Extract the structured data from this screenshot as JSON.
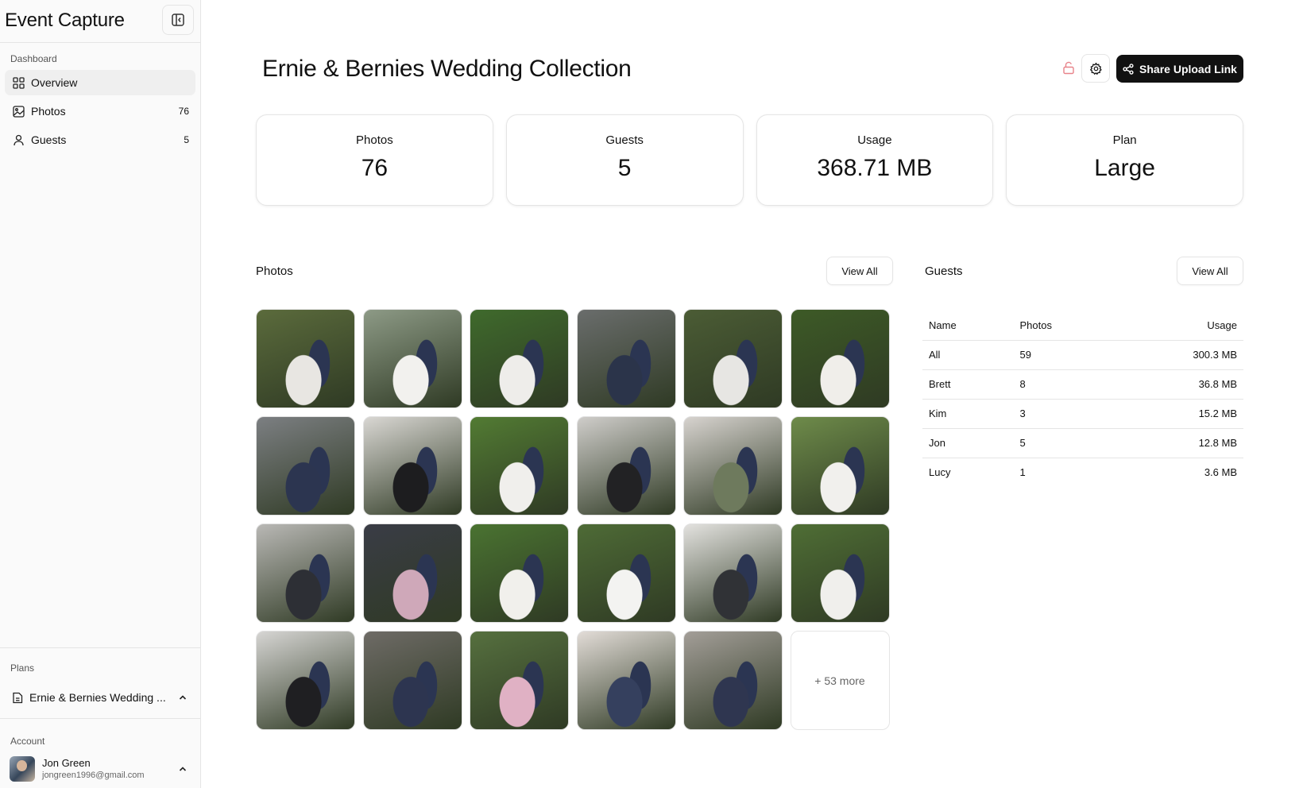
{
  "app": {
    "title": "Event Capture"
  },
  "sidebar": {
    "dashboard_label": "Dashboard",
    "items": [
      {
        "label": "Overview",
        "icon": "grid-icon",
        "count": ""
      },
      {
        "label": "Photos",
        "icon": "image-icon",
        "count": "76"
      },
      {
        "label": "Guests",
        "icon": "user-icon",
        "count": "5"
      }
    ],
    "plans_label": "Plans",
    "plan_name": "Ernie & Bernies Wedding ...",
    "account_label": "Account",
    "account": {
      "name": "Jon Green",
      "email": "jongreen1996@gmail.com"
    }
  },
  "header": {
    "title": "Ernie & Bernies Wedding Collection",
    "share_label": "Share Upload Link"
  },
  "stats": [
    {
      "label": "Photos",
      "value": "76"
    },
    {
      "label": "Guests",
      "value": "5"
    },
    {
      "label": "Usage",
      "value": "368.71 MB"
    },
    {
      "label": "Plan",
      "value": "Large"
    }
  ],
  "photos": {
    "title": "Photos",
    "view_all": "View All",
    "more_label": "+ 53 more",
    "thumbs": [
      {
        "bg": "#5b6b3c",
        "fg": "#e8e6e2"
      },
      {
        "bg": "#8d9a86",
        "fg": "#f2f1ee"
      },
      {
        "bg": "#3f6a2c",
        "fg": "#eeedea"
      },
      {
        "bg": "#6a6d6c",
        "fg": "#2b344a"
      },
      {
        "bg": "#4b5c35",
        "fg": "#e7e6e3"
      },
      {
        "bg": "#3d5a26",
        "fg": "#f0eeea"
      },
      {
        "bg": "#7c7f82",
        "fg": "#2c3550"
      },
      {
        "bg": "#d9d7d3",
        "fg": "#1d1d1f"
      },
      {
        "bg": "#527b33",
        "fg": "#f0efec"
      },
      {
        "bg": "#cfcdca",
        "fg": "#222224"
      },
      {
        "bg": "#d7d3cf",
        "fg": "#6e7a5d"
      },
      {
        "bg": "#6e8b4a",
        "fg": "#f1f0ed"
      },
      {
        "bg": "#b9b8b5",
        "fg": "#2d2f35"
      },
      {
        "bg": "#3a3c46",
        "fg": "#cfa8b9"
      },
      {
        "bg": "#4a7331",
        "fg": "#f1f0ec"
      },
      {
        "bg": "#4e6b36",
        "fg": "#f3f3f1"
      },
      {
        "bg": "#e3e2df",
        "fg": "#303236"
      },
      {
        "bg": "#4f6e35",
        "fg": "#f0efec"
      },
      {
        "bg": "#d6d5d3",
        "fg": "#1f1f22"
      },
      {
        "bg": "#6e6b66",
        "fg": "#2d3550"
      },
      {
        "bg": "#56703f",
        "fg": "#e0b1c4"
      },
      {
        "bg": "#e2dcd7",
        "fg": "#35405e"
      },
      {
        "bg": "#a39e98",
        "fg": "#2f3650"
      }
    ]
  },
  "guests": {
    "title": "Guests",
    "view_all": "View All",
    "columns": [
      "Name",
      "Photos",
      "Usage"
    ],
    "rows": [
      {
        "name": "All",
        "photos": "59",
        "usage": "300.3 MB"
      },
      {
        "name": "Brett",
        "photos": "8",
        "usage": "36.8 MB"
      },
      {
        "name": "Kim",
        "photos": "3",
        "usage": "15.2 MB"
      },
      {
        "name": "Jon",
        "photos": "5",
        "usage": "12.8 MB"
      },
      {
        "name": "Lucy",
        "photos": "1",
        "usage": "3.6 MB"
      }
    ]
  },
  "colors": {
    "primary_button": "#111111",
    "lock_icon": "#e8838a",
    "active_nav": "#efefef"
  }
}
